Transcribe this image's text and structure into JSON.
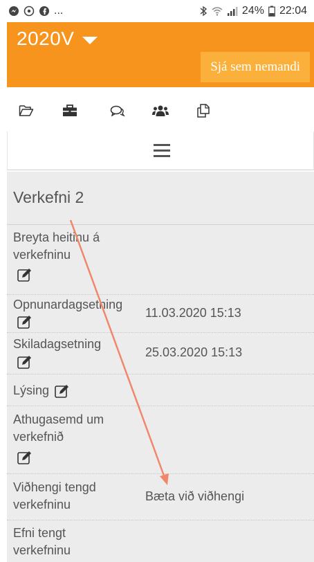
{
  "status_bar": {
    "left_icons": [
      "messenger-icon",
      "podcast-icon",
      "facebook-icon"
    ],
    "ellipsis": "...",
    "battery": "24%",
    "time": "22:04"
  },
  "header": {
    "course_title": "2020V",
    "view_as_student": "Sjá sem nemandi",
    "accent_color": "#f7941d"
  },
  "toolbar": {
    "items": [
      "folder-icon",
      "briefcase-icon",
      "comments-icon",
      "users-icon",
      "copy-icon"
    ]
  },
  "assignment": {
    "title": "Verkefni 2"
  },
  "rows": [
    {
      "label_line1": "Breyta heitinu á",
      "label_line2": "verkefninu",
      "value": ""
    },
    {
      "label_line1": "Opnunardagsetning",
      "label_line2": "",
      "value": "11.03.2020 15:13"
    },
    {
      "label_line1": "Skiladagsetning",
      "label_line2": "",
      "value": "25.03.2020 15:13"
    },
    {
      "label_line1": "Lýsing",
      "label_line2": "",
      "value": ""
    },
    {
      "label_line1": "Athugasemd um",
      "label_line2": "verkefnið",
      "value": ""
    },
    {
      "label_line1": "Viðhengi tengd",
      "label_line2": "verkefninu",
      "value": "Bæta við viðhengi"
    },
    {
      "label_line1": "Efni tengt",
      "label_line2": "verkefninu",
      "value": ""
    }
  ]
}
